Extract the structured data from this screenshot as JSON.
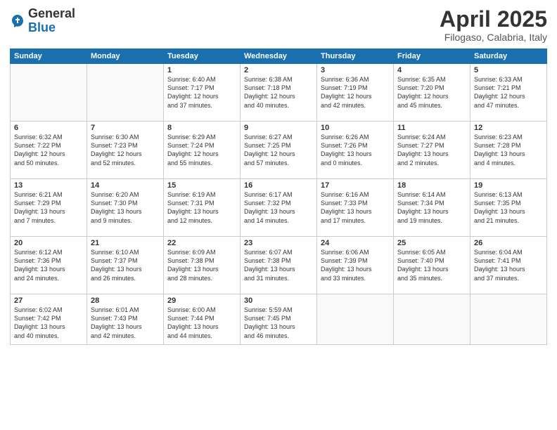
{
  "header": {
    "logo_general": "General",
    "logo_blue": "Blue",
    "title": "April 2025",
    "subtitle": "Filogaso, Calabria, Italy"
  },
  "weekdays": [
    "Sunday",
    "Monday",
    "Tuesday",
    "Wednesday",
    "Thursday",
    "Friday",
    "Saturday"
  ],
  "weeks": [
    [
      {
        "day": "",
        "info": ""
      },
      {
        "day": "",
        "info": ""
      },
      {
        "day": "1",
        "info": "Sunrise: 6:40 AM\nSunset: 7:17 PM\nDaylight: 12 hours\nand 37 minutes."
      },
      {
        "day": "2",
        "info": "Sunrise: 6:38 AM\nSunset: 7:18 PM\nDaylight: 12 hours\nand 40 minutes."
      },
      {
        "day": "3",
        "info": "Sunrise: 6:36 AM\nSunset: 7:19 PM\nDaylight: 12 hours\nand 42 minutes."
      },
      {
        "day": "4",
        "info": "Sunrise: 6:35 AM\nSunset: 7:20 PM\nDaylight: 12 hours\nand 45 minutes."
      },
      {
        "day": "5",
        "info": "Sunrise: 6:33 AM\nSunset: 7:21 PM\nDaylight: 12 hours\nand 47 minutes."
      }
    ],
    [
      {
        "day": "6",
        "info": "Sunrise: 6:32 AM\nSunset: 7:22 PM\nDaylight: 12 hours\nand 50 minutes."
      },
      {
        "day": "7",
        "info": "Sunrise: 6:30 AM\nSunset: 7:23 PM\nDaylight: 12 hours\nand 52 minutes."
      },
      {
        "day": "8",
        "info": "Sunrise: 6:29 AM\nSunset: 7:24 PM\nDaylight: 12 hours\nand 55 minutes."
      },
      {
        "day": "9",
        "info": "Sunrise: 6:27 AM\nSunset: 7:25 PM\nDaylight: 12 hours\nand 57 minutes."
      },
      {
        "day": "10",
        "info": "Sunrise: 6:26 AM\nSunset: 7:26 PM\nDaylight: 13 hours\nand 0 minutes."
      },
      {
        "day": "11",
        "info": "Sunrise: 6:24 AM\nSunset: 7:27 PM\nDaylight: 13 hours\nand 2 minutes."
      },
      {
        "day": "12",
        "info": "Sunrise: 6:23 AM\nSunset: 7:28 PM\nDaylight: 13 hours\nand 4 minutes."
      }
    ],
    [
      {
        "day": "13",
        "info": "Sunrise: 6:21 AM\nSunset: 7:29 PM\nDaylight: 13 hours\nand 7 minutes."
      },
      {
        "day": "14",
        "info": "Sunrise: 6:20 AM\nSunset: 7:30 PM\nDaylight: 13 hours\nand 9 minutes."
      },
      {
        "day": "15",
        "info": "Sunrise: 6:19 AM\nSunset: 7:31 PM\nDaylight: 13 hours\nand 12 minutes."
      },
      {
        "day": "16",
        "info": "Sunrise: 6:17 AM\nSunset: 7:32 PM\nDaylight: 13 hours\nand 14 minutes."
      },
      {
        "day": "17",
        "info": "Sunrise: 6:16 AM\nSunset: 7:33 PM\nDaylight: 13 hours\nand 17 minutes."
      },
      {
        "day": "18",
        "info": "Sunrise: 6:14 AM\nSunset: 7:34 PM\nDaylight: 13 hours\nand 19 minutes."
      },
      {
        "day": "19",
        "info": "Sunrise: 6:13 AM\nSunset: 7:35 PM\nDaylight: 13 hours\nand 21 minutes."
      }
    ],
    [
      {
        "day": "20",
        "info": "Sunrise: 6:12 AM\nSunset: 7:36 PM\nDaylight: 13 hours\nand 24 minutes."
      },
      {
        "day": "21",
        "info": "Sunrise: 6:10 AM\nSunset: 7:37 PM\nDaylight: 13 hours\nand 26 minutes."
      },
      {
        "day": "22",
        "info": "Sunrise: 6:09 AM\nSunset: 7:38 PM\nDaylight: 13 hours\nand 28 minutes."
      },
      {
        "day": "23",
        "info": "Sunrise: 6:07 AM\nSunset: 7:38 PM\nDaylight: 13 hours\nand 31 minutes."
      },
      {
        "day": "24",
        "info": "Sunrise: 6:06 AM\nSunset: 7:39 PM\nDaylight: 13 hours\nand 33 minutes."
      },
      {
        "day": "25",
        "info": "Sunrise: 6:05 AM\nSunset: 7:40 PM\nDaylight: 13 hours\nand 35 minutes."
      },
      {
        "day": "26",
        "info": "Sunrise: 6:04 AM\nSunset: 7:41 PM\nDaylight: 13 hours\nand 37 minutes."
      }
    ],
    [
      {
        "day": "27",
        "info": "Sunrise: 6:02 AM\nSunset: 7:42 PM\nDaylight: 13 hours\nand 40 minutes."
      },
      {
        "day": "28",
        "info": "Sunrise: 6:01 AM\nSunset: 7:43 PM\nDaylight: 13 hours\nand 42 minutes."
      },
      {
        "day": "29",
        "info": "Sunrise: 6:00 AM\nSunset: 7:44 PM\nDaylight: 13 hours\nand 44 minutes."
      },
      {
        "day": "30",
        "info": "Sunrise: 5:59 AM\nSunset: 7:45 PM\nDaylight: 13 hours\nand 46 minutes."
      },
      {
        "day": "",
        "info": ""
      },
      {
        "day": "",
        "info": ""
      },
      {
        "day": "",
        "info": ""
      }
    ]
  ]
}
